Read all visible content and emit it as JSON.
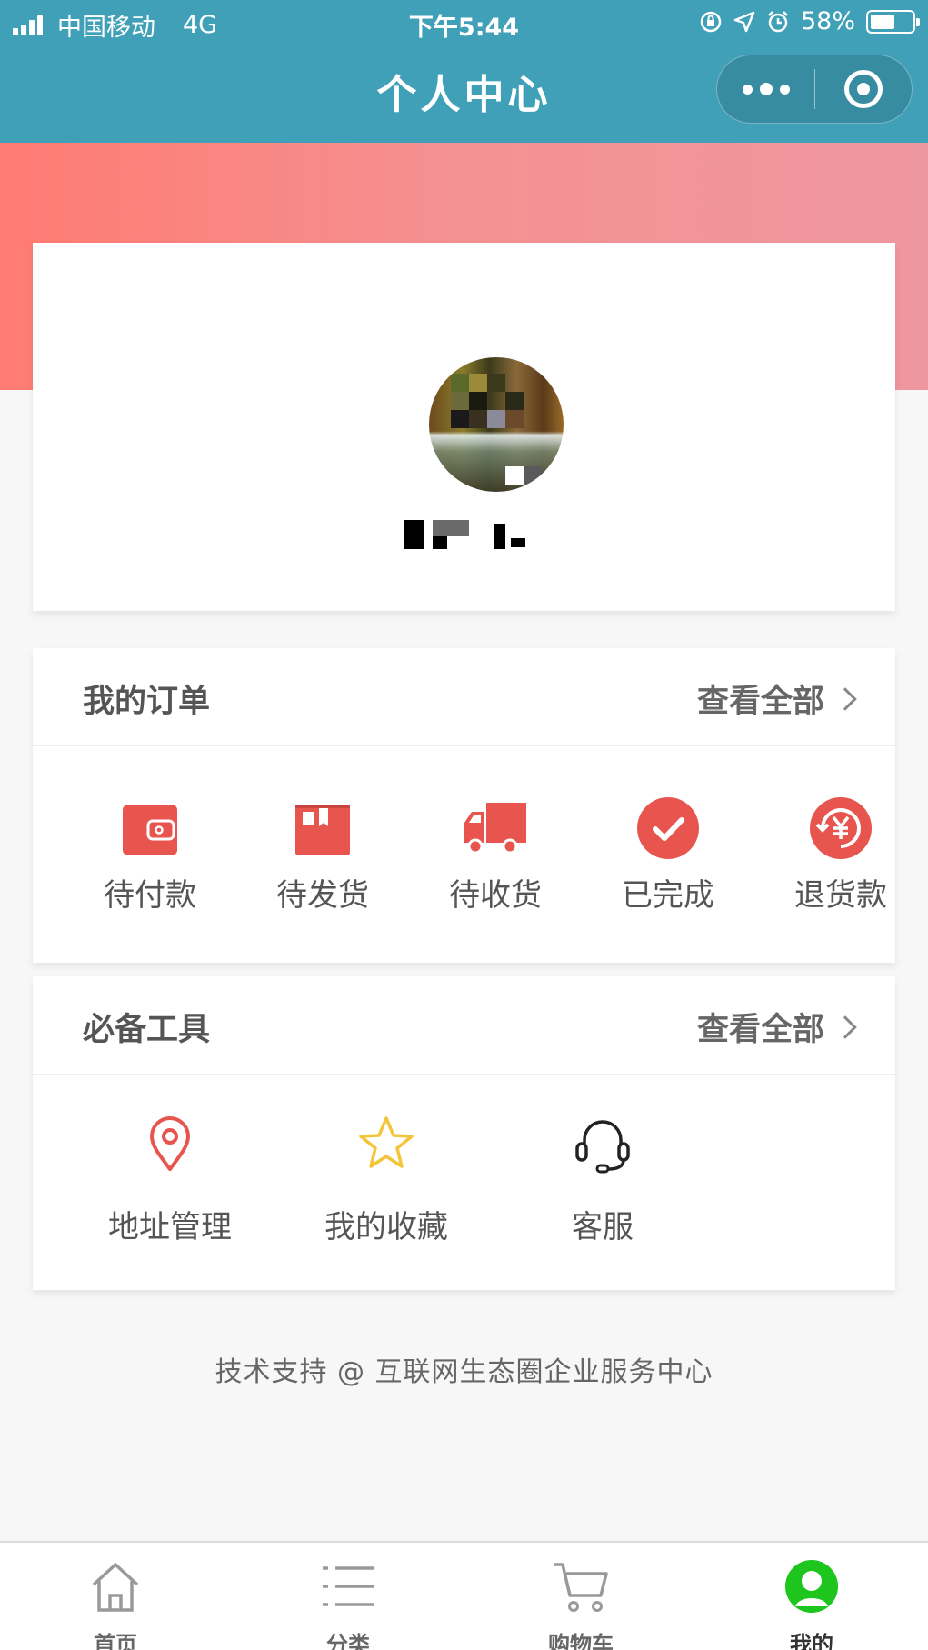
{
  "status_bar": {
    "carrier": "中国移动",
    "network": "4G",
    "time": "下午5:44",
    "battery": "58%",
    "battery_level": 0.58
  },
  "nav": {
    "title": "个人中心"
  },
  "orders": {
    "title": "我的订单",
    "view_all": "查看全部",
    "items": [
      {
        "label": "待付款",
        "icon": "wallet-icon"
      },
      {
        "label": "待发货",
        "icon": "box-icon"
      },
      {
        "label": "待收货",
        "icon": "truck-icon"
      },
      {
        "label": "已完成",
        "icon": "check-circle-icon"
      },
      {
        "label": "退货款",
        "icon": "refund-icon"
      }
    ]
  },
  "tools": {
    "title": "必备工具",
    "view_all": "查看全部",
    "items": [
      {
        "label": "地址管理",
        "icon": "location-pin-icon"
      },
      {
        "label": "我的收藏",
        "icon": "star-icon"
      },
      {
        "label": "客服",
        "icon": "headset-icon"
      }
    ]
  },
  "footer_note": "技术支持 @ 互联网生态圈企业服务中心",
  "tabbar": {
    "items": [
      {
        "label": "首页",
        "icon": "home-icon"
      },
      {
        "label": "分类",
        "icon": "list-icon"
      },
      {
        "label": "购物车",
        "icon": "cart-icon"
      },
      {
        "label": "我的",
        "icon": "user-icon",
        "active": true
      }
    ]
  },
  "colors": {
    "nav_bg": "#3fa0b8",
    "accent_red": "#e8544e",
    "star_yellow": "#f3c53b",
    "active_green": "#1dc51d"
  }
}
